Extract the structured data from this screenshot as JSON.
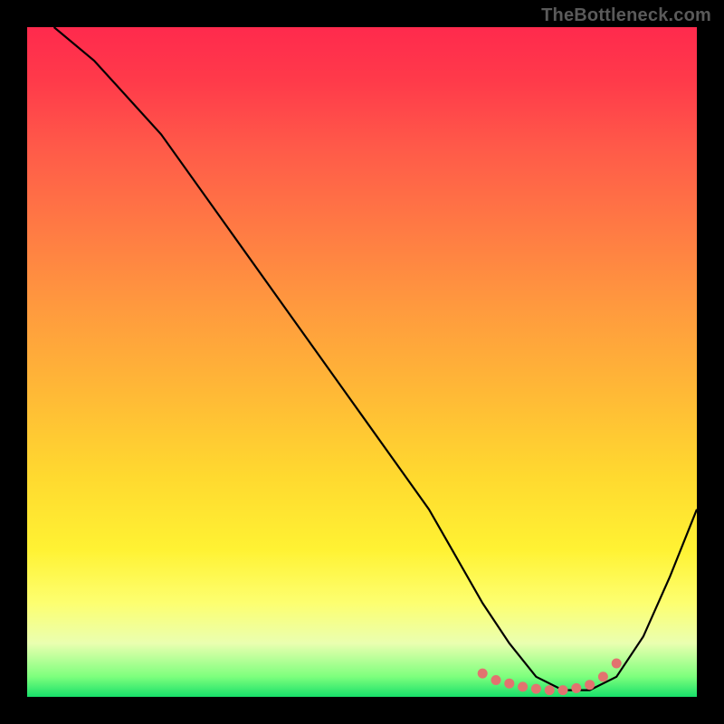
{
  "watermark": "TheBottleneck.com",
  "chart_data": {
    "type": "line",
    "title": "",
    "xlabel": "",
    "ylabel": "",
    "xlim": [
      0,
      100
    ],
    "ylim": [
      0,
      100
    ],
    "series": [
      {
        "name": "curve",
        "x": [
          4,
          10,
          20,
          30,
          40,
          50,
          60,
          64,
          68,
          72,
          76,
          80,
          84,
          88,
          92,
          96,
          100
        ],
        "y": [
          100,
          95,
          84,
          70,
          56,
          42,
          28,
          21,
          14,
          8,
          3,
          1,
          1,
          3,
          9,
          18,
          28
        ]
      }
    ],
    "markers": {
      "name": "bottom-dots",
      "color": "#e2736f",
      "x": [
        68,
        70,
        72,
        74,
        76,
        78,
        80,
        82,
        84,
        86,
        88
      ],
      "y": [
        3.5,
        2.5,
        2,
        1.5,
        1.2,
        1,
        1,
        1.3,
        1.8,
        3,
        5
      ]
    },
    "background_gradient": {
      "stops": [
        {
          "pos": 0,
          "color": "#ff2a4d"
        },
        {
          "pos": 30,
          "color": "#ff7a44"
        },
        {
          "pos": 67,
          "color": "#ffd92f"
        },
        {
          "pos": 86,
          "color": "#fdff70"
        },
        {
          "pos": 100,
          "color": "#18e06a"
        }
      ]
    }
  }
}
